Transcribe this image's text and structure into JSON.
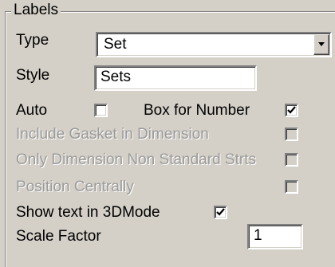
{
  "group": {
    "title": "Labels",
    "type": {
      "label": "Type",
      "value": "Set"
    },
    "style": {
      "label": "Style",
      "value": "Sets"
    },
    "auto": {
      "label": "Auto",
      "checked": false
    },
    "box_for_number": {
      "label": "Box for Number",
      "checked": true
    },
    "include_gasket": {
      "label": "Include Gasket in Dimension",
      "checked": false,
      "enabled": false
    },
    "only_non_standard": {
      "label": "Only Dimension Non Standard Strts",
      "checked": false,
      "enabled": false
    },
    "position_centrally": {
      "label": "Position Centrally",
      "checked": false,
      "enabled": false
    },
    "show_text_3d": {
      "label": "Show text in 3DMode",
      "checked": true
    },
    "scale_factor": {
      "label": "Scale Factor",
      "value": "1"
    }
  },
  "icons": {
    "dropdown": "chevron-down-icon",
    "check": "checkmark-icon"
  }
}
